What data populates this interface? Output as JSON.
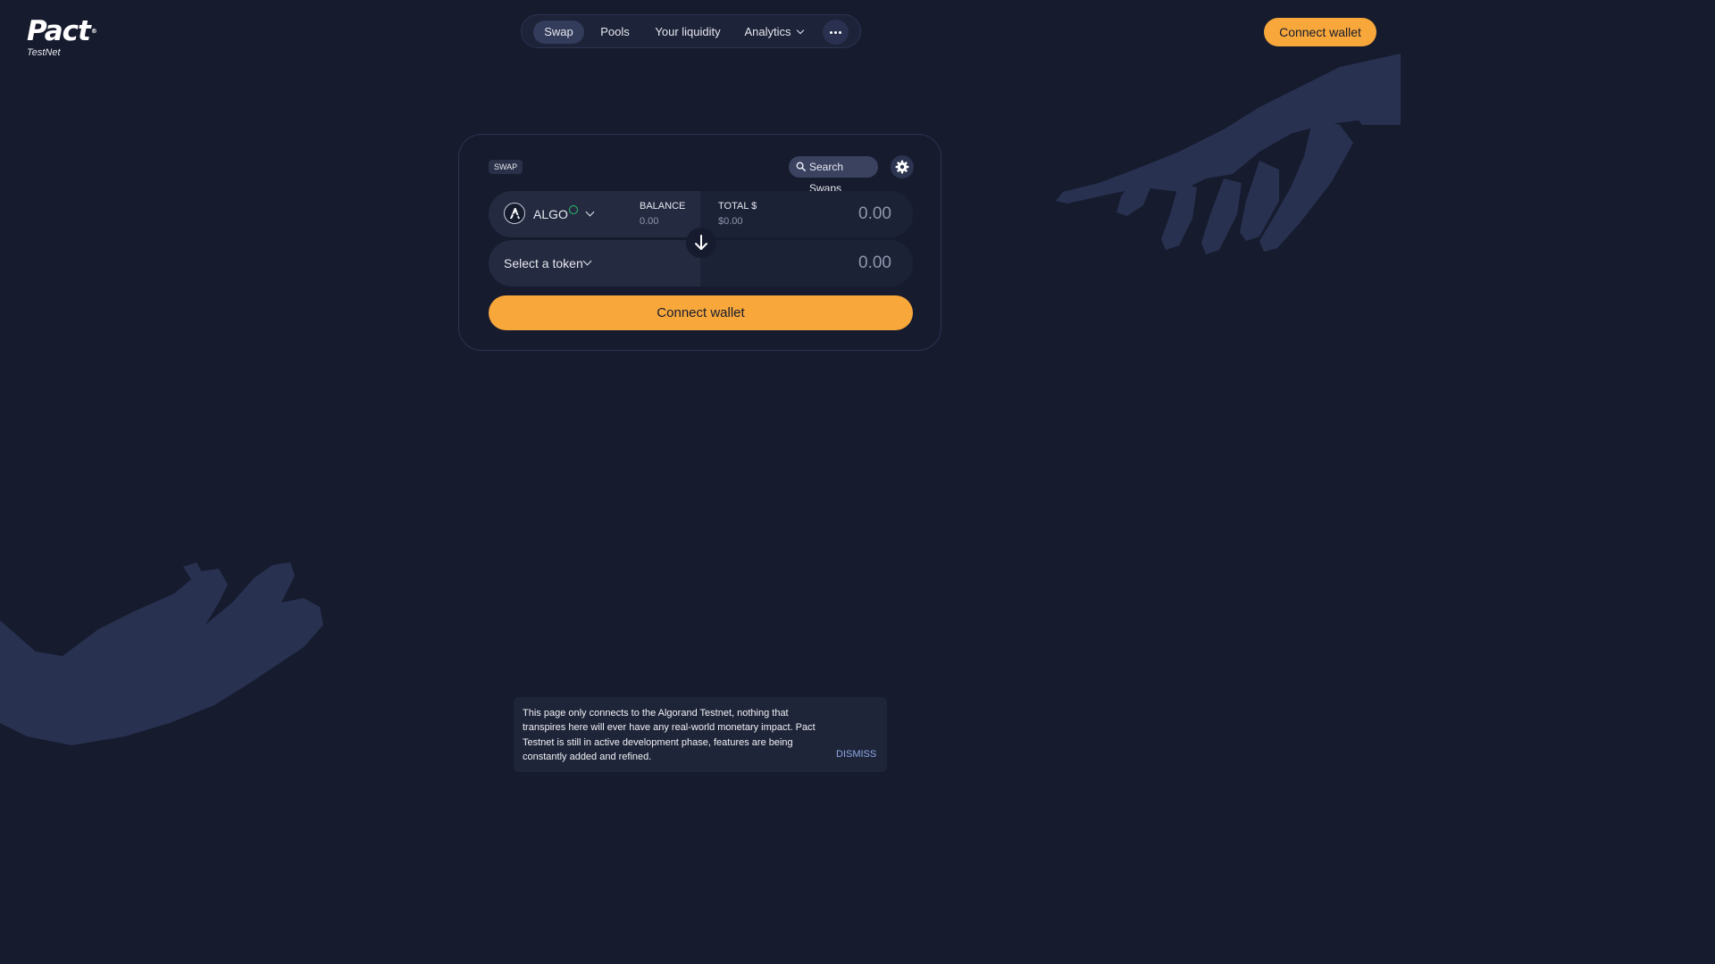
{
  "brand": {
    "name": "Pact",
    "registered_mark": "®",
    "network": "TestNet"
  },
  "nav": {
    "items": [
      {
        "label": "Swap",
        "active": true
      },
      {
        "label": "Pools"
      },
      {
        "label": "Your liquidity"
      },
      {
        "label": "Analytics",
        "has_dropdown": true
      }
    ],
    "more_icon": "more-horizontal-icon"
  },
  "header": {
    "connect_label": "Connect wallet"
  },
  "swap": {
    "tag": "SWAP",
    "search_label": "Search Swaps",
    "search_icon": "search-icon",
    "settings_icon": "gear-icon",
    "from": {
      "token": "ALGO",
      "token_icon": "algorand-icon",
      "verified_icon": "verified-check-icon",
      "balance_label": "BALANCE",
      "balance_value": "0.00",
      "total_label": "TOTAL $",
      "total_value": "$0.00",
      "amount": "0.00"
    },
    "switch_icon": "arrow-down-icon",
    "to": {
      "token_placeholder": "Select a token",
      "amount": "0.00"
    },
    "connect_label": "Connect wallet"
  },
  "notice": {
    "text": "This page only connects to the Algorand Testnet, nothing that transpires here will ever have any real-world monetary impact. Pact Testnet is still in active development phase, features are being constantly added and refined.",
    "dismiss_label": "DISMISS"
  },
  "colors": {
    "background": "#161b2e",
    "accent": "#f8a83b",
    "card_row": "#242a40",
    "illustration": "#2a3350"
  }
}
